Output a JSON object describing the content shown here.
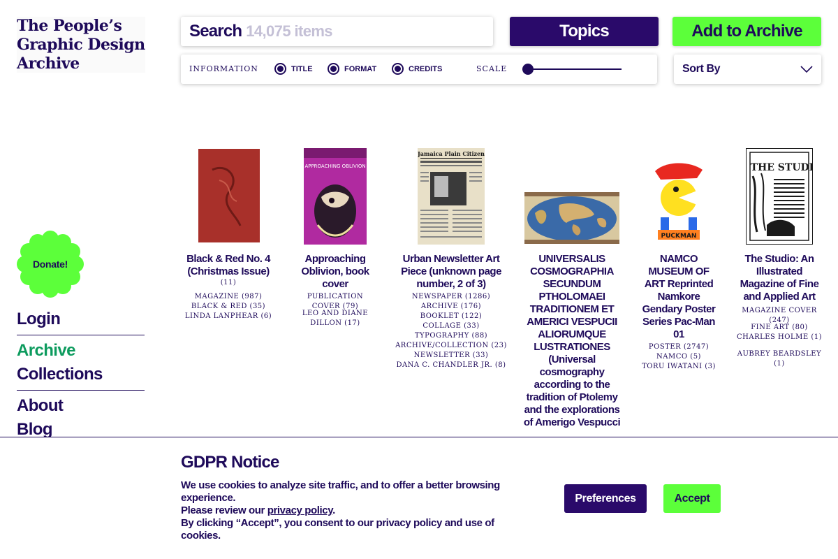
{
  "logo": {
    "line1": "The People’s",
    "line2": "Graphic Design",
    "line3": "Archive"
  },
  "search": {
    "label": "Search",
    "placeholder": "14,075 items"
  },
  "header": {
    "topics_label": "Topics",
    "add_label": "Add to Archive"
  },
  "filters": {
    "information_label": "INFORMATION",
    "options": [
      "TITLE",
      "FORMAT",
      "CREDITS"
    ],
    "scale_label": "SCALE",
    "scale_value": 0
  },
  "sort": {
    "label": "Sort By"
  },
  "donate": {
    "label": "Donate!"
  },
  "nav": {
    "login": "Login",
    "archive": "Archive",
    "collections": "Collections",
    "about": "About",
    "blog": "Blog"
  },
  "items": [
    {
      "title": "Black & Red No. 4 (Christmas Issue)",
      "count": "(11)",
      "tags": [
        "MAGAZINE (987)",
        "BLACK & RED (35)",
        "LINDA LANPHEAR (6)"
      ]
    },
    {
      "title": "Approaching Oblivion, book cover",
      "tags": [
        "PUBLICATION COVER (79)",
        "LEO AND DIANE DILLON (17)"
      ]
    },
    {
      "title": "Urban Newsletter Art Piece (unknown page number, 2 of 3)",
      "tags": [
        "NEWSPAPER (1286)",
        "ARCHIVE (176)",
        "BOOKLET (122)",
        "COLLAGE (33)",
        "TYPOGRAPHY (88)",
        "ARCHIVE/COLLECTION (23)",
        "NEWSLETTER (33)",
        "DANA C. CHANDLER JR. (8)"
      ]
    },
    {
      "title": "UNIVERSALIS COSMOGRAPHIA SECUNDUM PTHOLOMAEI TRADITIONEM ET AMERICI VESPUCII ALIORUMQUE LUSTRATIONES (Universal cosmography according to the tradition of Ptolemy and the explorations of Amerigo Vespucci"
    },
    {
      "title": "NAMCO MUSEUM OF ART Reprinted Namkore Gendary Poster Series Pac-Man 01",
      "tags": [
        "POSTER (2747)",
        "NAMCO (5)",
        "TORU IWATANI (3)"
      ]
    },
    {
      "title": "The Studio: An Illustrated Magazine of Fine and Applied Art",
      "tags": [
        "MAGAZINE COVER (247)",
        "FINE ART (80)",
        "CHARLES HOLME (1)",
        "AUBREY BEARDSLEY (1)"
      ]
    }
  ],
  "thumb_text": {
    "oblivion": "APPROACHING OBLIVION",
    "urban_masthead": "Jamaica Plain Citizen",
    "namco": "PUCKMAN",
    "studio": "THE STUDIO"
  },
  "gdpr": {
    "title": "GDPR Notice",
    "line1": "We use cookies to analyze site traffic, and to offer a better browsing experience.",
    "line2_pre": "Please review our ",
    "line2_link": "privacy policy",
    "line2_post": ".",
    "line3": "By clicking “Accept”, you consent to our privacy policy and use of cookies.",
    "preferences_label": "Preferences",
    "accept_label": "Accept"
  },
  "colors": {
    "brand": "#1e0a5a",
    "accent_green": "#5cff3a",
    "button_dark": "#2a0a6a",
    "active_nav": "#0d9b5e"
  }
}
